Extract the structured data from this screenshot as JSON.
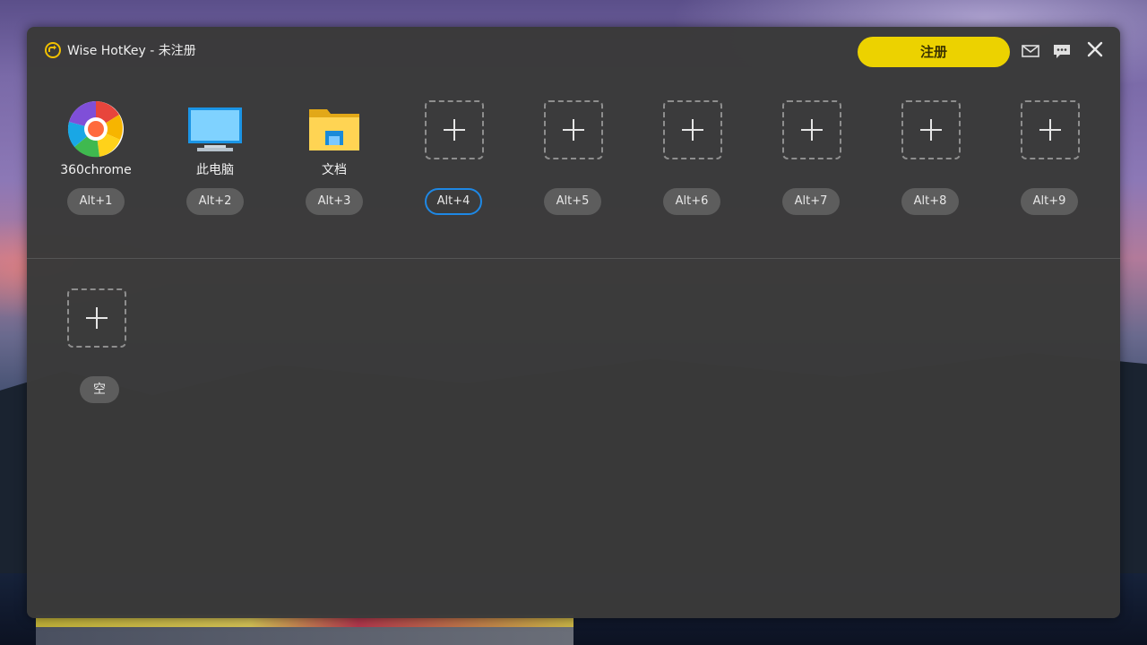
{
  "window": {
    "title": "Wise HotKey - 未注册",
    "register_label": "注册",
    "accent_color": "#ecd200",
    "active_hotkey_color": "#1e88e5"
  },
  "slots": [
    {
      "label": "360chrome",
      "hotkey": "Alt+1",
      "icon": "360chrome-icon"
    },
    {
      "label": "此电脑",
      "hotkey": "Alt+2",
      "icon": "computer-icon"
    },
    {
      "label": "文档",
      "hotkey": "Alt+3",
      "icon": "folder-icon"
    },
    {
      "label": "",
      "hotkey": "Alt+4",
      "icon": "add-icon",
      "active": true
    },
    {
      "label": "",
      "hotkey": "Alt+5",
      "icon": "add-icon"
    },
    {
      "label": "",
      "hotkey": "Alt+6",
      "icon": "add-icon"
    },
    {
      "label": "",
      "hotkey": "Alt+7",
      "icon": "add-icon"
    },
    {
      "label": "",
      "hotkey": "Alt+8",
      "icon": "add-icon"
    },
    {
      "label": "",
      "hotkey": "Alt+9",
      "icon": "add-icon"
    }
  ],
  "second_row": {
    "empty_label": "空"
  }
}
